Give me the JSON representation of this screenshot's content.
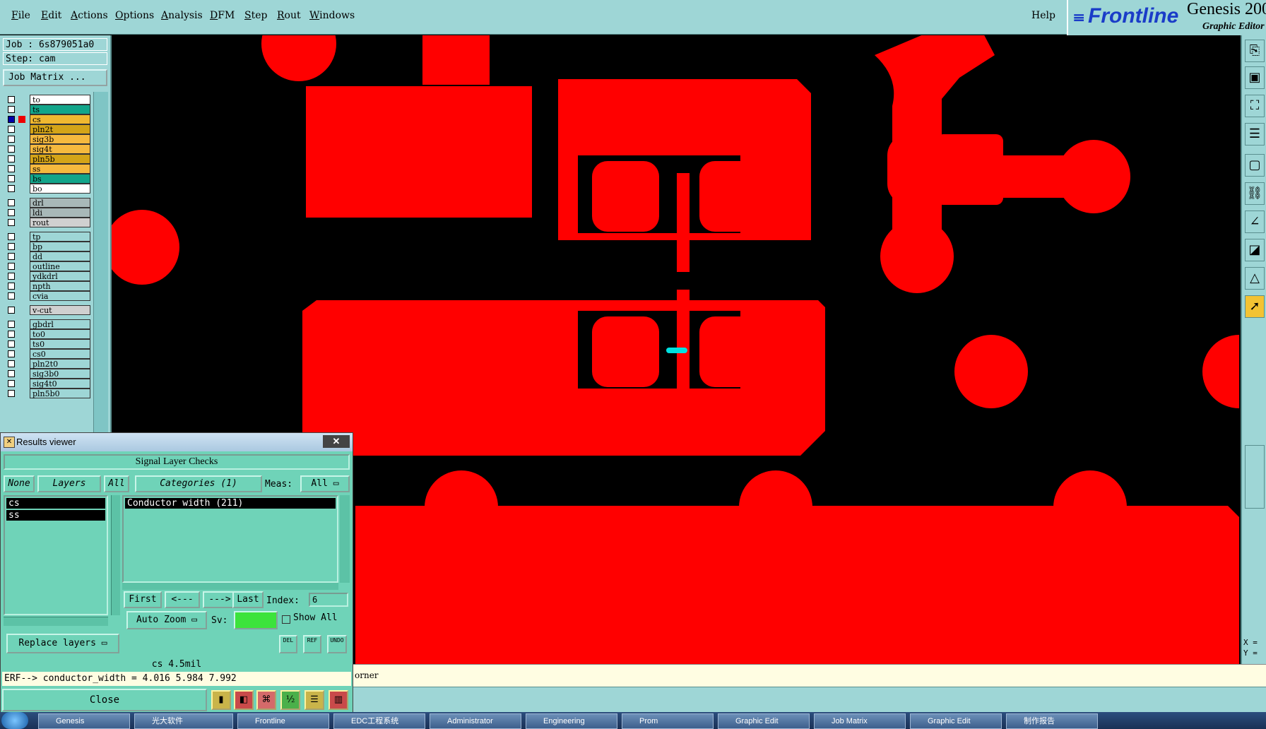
{
  "menubar": {
    "items": [
      "File",
      "Edit",
      "Actions",
      "Options",
      "Analysis",
      "DFM",
      "Step",
      "Rout",
      "Windows"
    ],
    "help": "Help"
  },
  "brand": {
    "logo": "Frontline",
    "product": "Genesis 200",
    "subtitle": "Graphic Editor"
  },
  "job": {
    "job_label": "Job : 6s879051a0",
    "step_label": "Step: cam",
    "matrix_button": "Job Matrix ..."
  },
  "layers": [
    {
      "name": "to",
      "color": "#ffffff"
    },
    {
      "name": "ts",
      "color": "#12a58a"
    },
    {
      "name": "cs",
      "color": "#f0b830",
      "active": true
    },
    {
      "name": "pln2t",
      "color": "#d4a418"
    },
    {
      "name": "sig3b",
      "color": "#f5b93e"
    },
    {
      "name": "sig4t",
      "color": "#f5b93e"
    },
    {
      "name": "pln5b",
      "color": "#d4a418"
    },
    {
      "name": "ss",
      "color": "#f5b93e"
    },
    {
      "name": "bs",
      "color": "#12a58a"
    },
    {
      "name": "bo",
      "color": "#ffffff"
    },
    {
      "name": "drl",
      "color": "#a8b8b8"
    },
    {
      "name": "ldi",
      "color": "#a8b8b8"
    },
    {
      "name": "rout",
      "color": "#d0d0d0"
    },
    {
      "name": "tp",
      "color": "#9ed6d6"
    },
    {
      "name": "bp",
      "color": "#9ed6d6"
    },
    {
      "name": "dd",
      "color": "#9ed6d6"
    },
    {
      "name": "outline",
      "color": "#9ed6d6"
    },
    {
      "name": "ydkdrl",
      "color": "#9ed6d6"
    },
    {
      "name": "npth",
      "color": "#9ed6d6"
    },
    {
      "name": "cvia",
      "color": "#9ed6d6"
    },
    {
      "name": "v-cut",
      "color": "#d0d0d0"
    },
    {
      "name": "gbdrl",
      "color": "#9ed6d6"
    },
    {
      "name": "to0",
      "color": "#9ed6d6"
    },
    {
      "name": "ts0",
      "color": "#9ed6d6"
    },
    {
      "name": "cs0",
      "color": "#9ed6d6"
    },
    {
      "name": "pln2t0",
      "color": "#9ed6d6"
    },
    {
      "name": "sig3b0",
      "color": "#9ed6d6"
    },
    {
      "name": "sig4t0",
      "color": "#9ed6d6"
    },
    {
      "name": "pln5b0",
      "color": "#9ed6d6"
    }
  ],
  "canvas": {
    "copper_color": "#ff0000",
    "marker_color": "#00e0e0"
  },
  "coords": {
    "x": "X =",
    "y": "Y ="
  },
  "status": {
    "line": "orner"
  },
  "results": {
    "title": "Results viewer",
    "close_x": "✕",
    "header": "Signal Layer Checks",
    "none_btn": "None",
    "layers_btn": "Layers",
    "all_btn": "All",
    "categories_btn": "Categories (1)",
    "meas_label": "Meas:",
    "meas_value": "All",
    "layer_items": [
      "cs",
      "ss"
    ],
    "category_items": [
      "Conductor width (211)"
    ],
    "first_btn": "First",
    "prev_btn": "<---",
    "next_btn": "--->",
    "last_btn": "Last",
    "index_label": "Index:",
    "index_value": "6",
    "auto_zoom": "Auto Zoom",
    "sv_label": "Sv:",
    "show_all": "Show All",
    "replace_layers": "Replace layers",
    "del_btn": "DEL",
    "ref_btn": "REF",
    "undo_btn": "UNDO",
    "status1": "cs 4.5mil",
    "status2": "ERF--> conductor_width = 4.016 5.984 7.992",
    "close_btn": "Close"
  },
  "taskbar": {
    "items": [
      "Genesis",
      "光大软件",
      "Frontline",
      "EDC工程系统",
      "Administrator",
      "Engineering",
      "Prom",
      "Graphic Edit",
      "Job Matrix",
      "Graphic Edit",
      "制作报告"
    ]
  }
}
